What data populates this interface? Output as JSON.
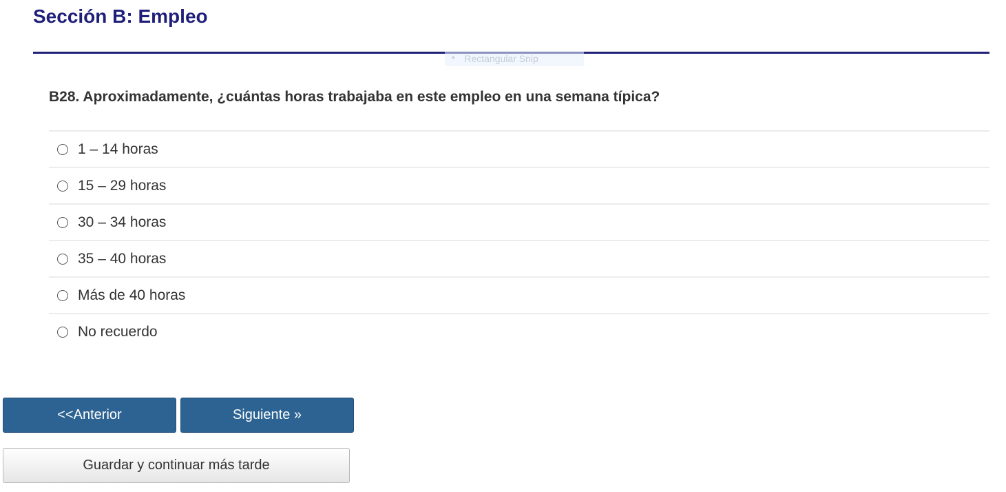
{
  "section": {
    "title": "Sección B: Empleo"
  },
  "overlay": {
    "label": "Rectangular Snip",
    "icon": "scissors-icon"
  },
  "question": {
    "text": "B28. Aproximadamente, ¿cuántas horas trabajaba en este empleo en una semana típica?",
    "selected": null,
    "options": [
      {
        "label": "1 – 14 horas"
      },
      {
        "label": "15 – 29 horas"
      },
      {
        "label": "30 – 34 horas"
      },
      {
        "label": "35 – 40 horas"
      },
      {
        "label": "Más de 40 horas"
      },
      {
        "label": "No recuerdo"
      }
    ]
  },
  "navigation": {
    "previous_label": "<<Anterior",
    "next_label": "Siguiente »",
    "save_label": "Guardar y continuar más tarde"
  },
  "colors": {
    "heading": "#1f1f7a",
    "primary_button": "#2c6393",
    "text": "#333333"
  }
}
